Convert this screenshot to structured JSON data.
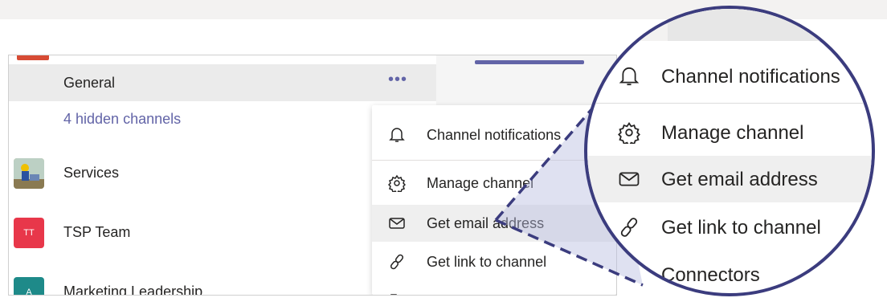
{
  "channels": {
    "general_label": "General",
    "more_label": "•••",
    "hidden_channels_label": "4 hidden channels"
  },
  "teams": [
    {
      "name": "Services",
      "avatar_text": ""
    },
    {
      "name": "TSP Team",
      "avatar_text": "TT"
    },
    {
      "name": "Marketing Leadership",
      "avatar_text": "A"
    }
  ],
  "menu": {
    "items": [
      {
        "label": "Channel notifications",
        "icon": "bell-icon"
      },
      {
        "label": "Manage channel",
        "icon": "gear-icon"
      },
      {
        "label": "Get email address",
        "icon": "envelope-icon"
      },
      {
        "label": "Get link to channel",
        "icon": "link-icon"
      },
      {
        "label": "Connectors",
        "icon": "connector-icon"
      }
    ]
  },
  "colors": {
    "accent": "#6264a7",
    "zoom_border": "#3b3c7e",
    "tsp_avatar": "#e8374a",
    "marketing_avatar": "#1e8a89"
  }
}
